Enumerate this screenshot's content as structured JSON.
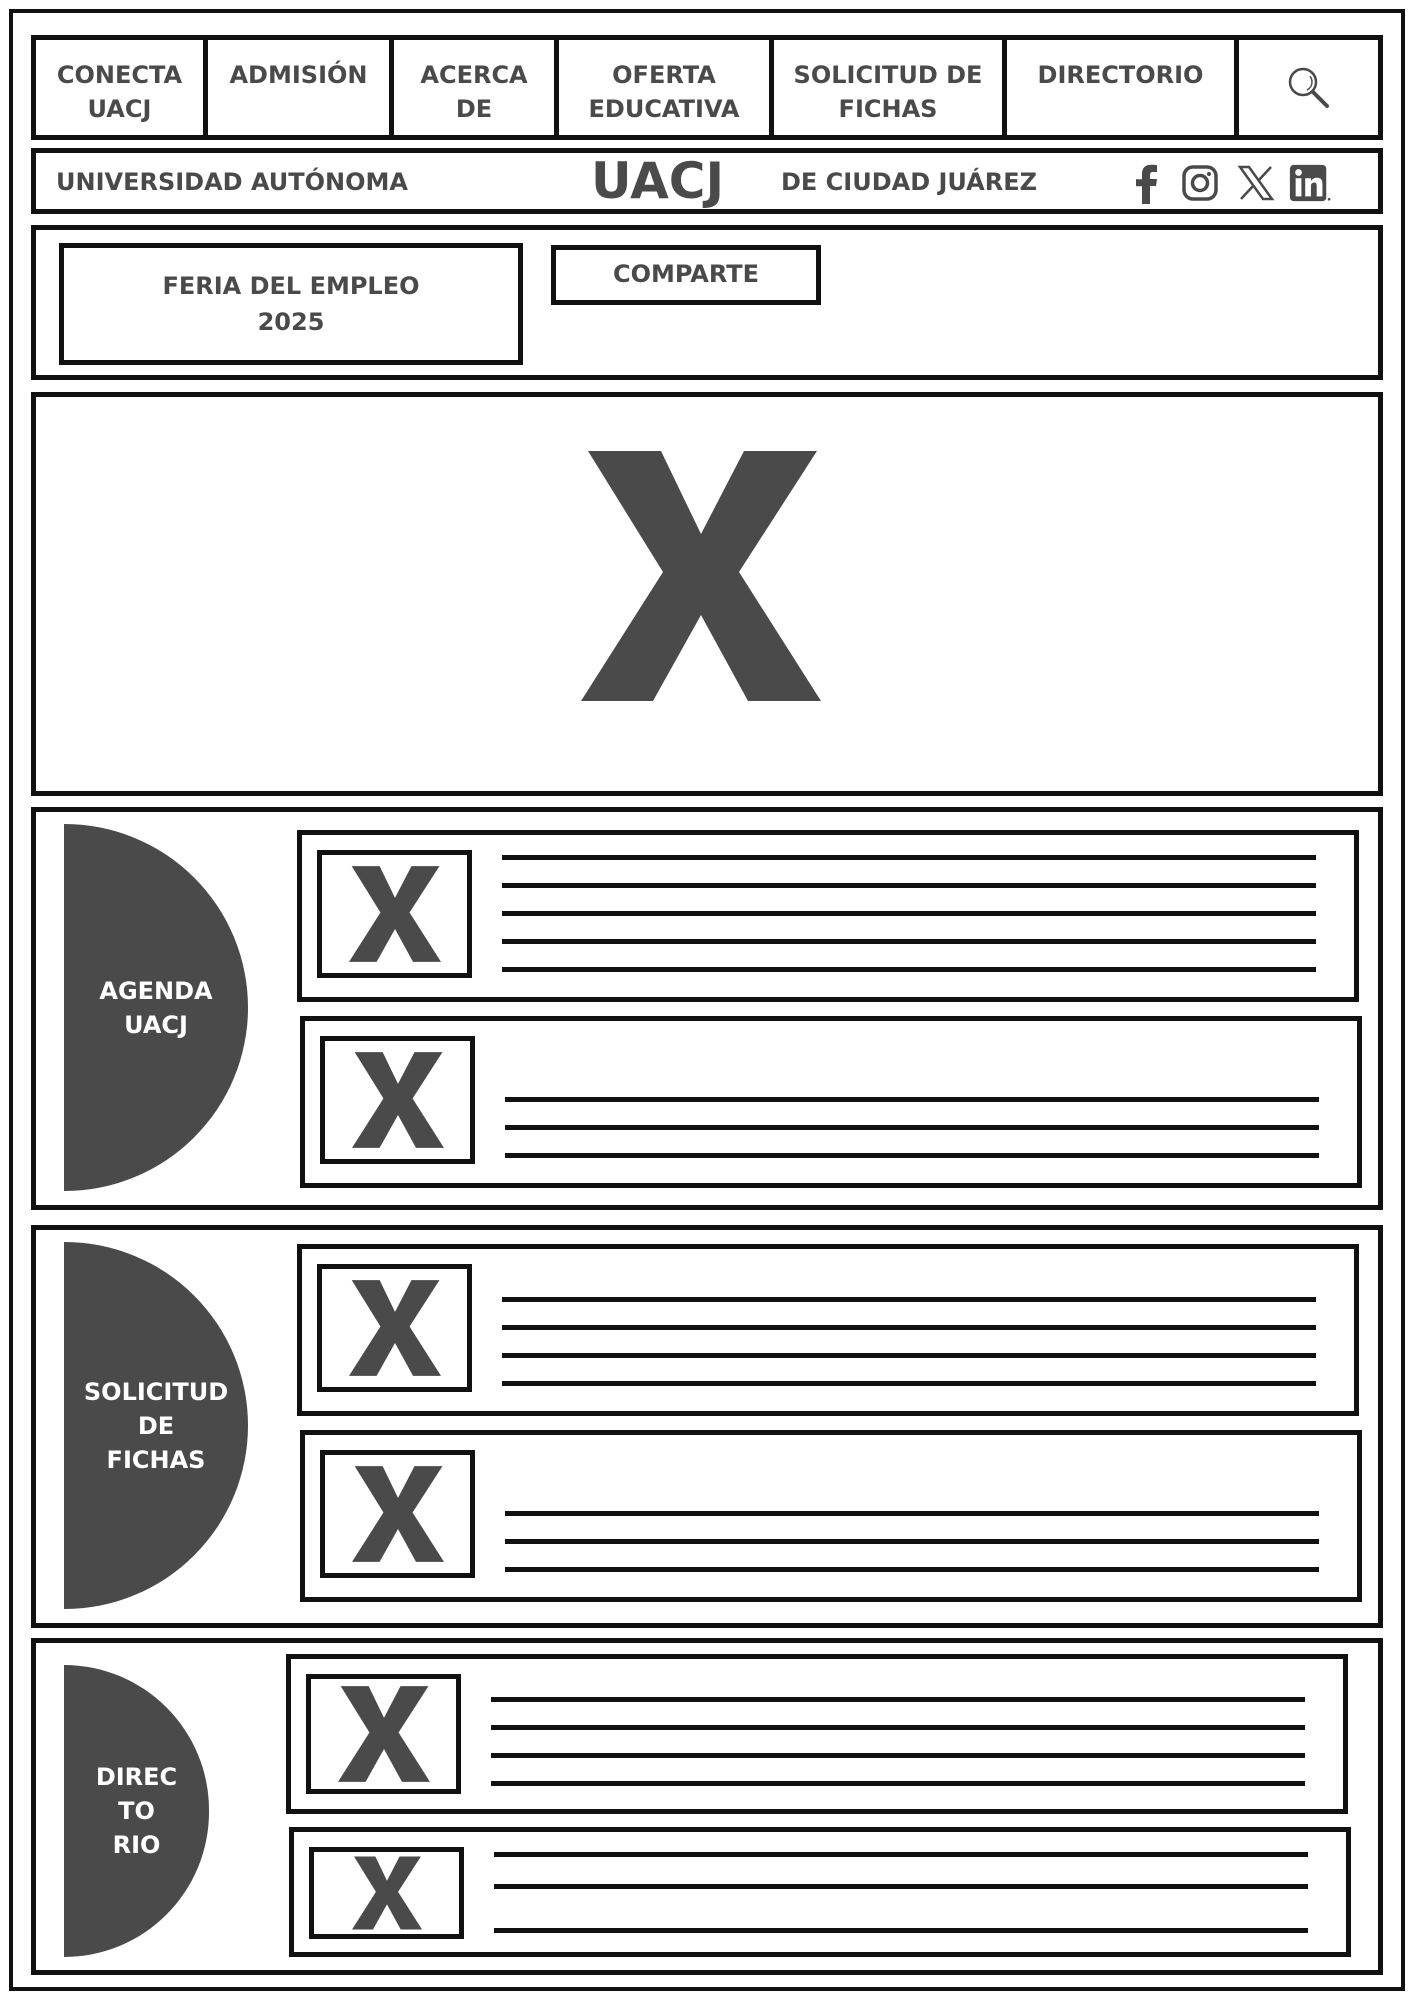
{
  "nav": {
    "items": [
      {
        "label": "CONECTA\nUACJ"
      },
      {
        "label": "ADMISIÓN"
      },
      {
        "label": "ACERCA\nDE"
      },
      {
        "label": "OFERTA\nEDUCATIVA"
      },
      {
        "label": "SOLICITUD DE\nFICHAS"
      },
      {
        "label": "DIRECTORIO"
      }
    ],
    "search_icon": "search-icon"
  },
  "brand": {
    "left_text": "UNIVERSIDAD AUTÓNOMA",
    "logo": "UACJ",
    "right_text": "DE CIUDAD JUÁREZ",
    "social_icons": [
      "facebook-icon",
      "instagram-icon",
      "x-twitter-icon",
      "linkedin-icon"
    ]
  },
  "banner": {
    "feria_label": "FERIA DEL EMPLEO\n2025",
    "comparte_label": "COMPARTE"
  },
  "hero": {
    "placeholder_icon": "image-placeholder-icon"
  },
  "sections": [
    {
      "label": "AGENDA\nUACJ"
    },
    {
      "label": "SOLICITUD\nDE\nFICHAS"
    },
    {
      "label": "DIREC\nTO\nRIO"
    }
  ],
  "colors": {
    "fill": "#4a4a4a",
    "stroke": "#111111",
    "background": "#ffffff"
  }
}
